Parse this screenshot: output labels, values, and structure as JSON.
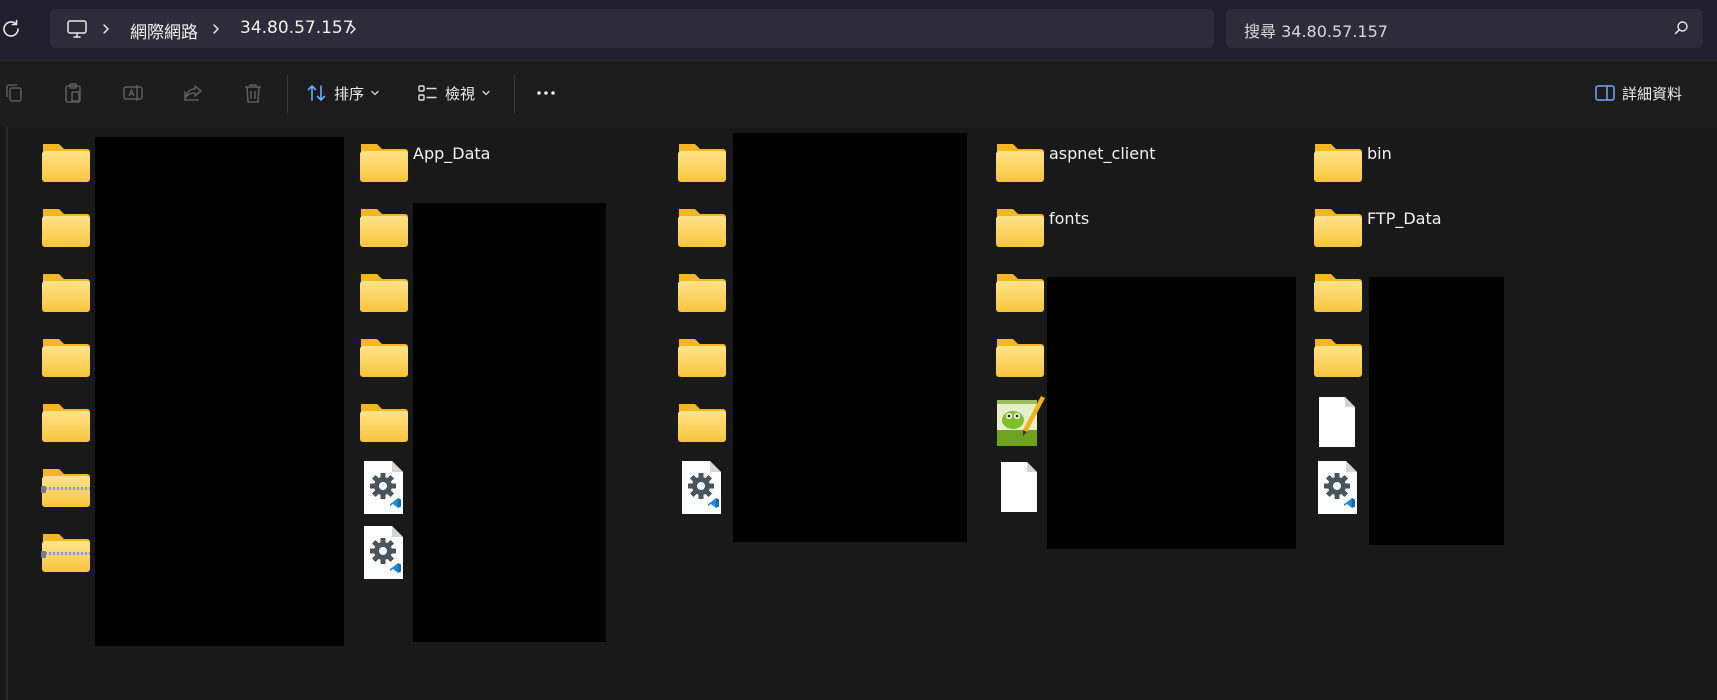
{
  "address": {
    "crumbs": [
      "網際網路",
      "34.80.57.157"
    ]
  },
  "search": {
    "placeholder": "搜尋 34.80.57.157"
  },
  "toolbar": {
    "sort_label": "排序",
    "view_label": "檢視",
    "details_label": "詳細資料"
  },
  "items": {
    "app_data": "App_Data",
    "aspnet_client": "aspnet_client",
    "bin": "bin",
    "fonts": "fonts",
    "ftp_data": "FTP_Data"
  },
  "colors": {
    "background": "#191919",
    "titlebar": "#211f2b",
    "address_bar": "#2e2c38",
    "folder_yellow": "#ffd65c",
    "folder_tab": "#f5b623"
  },
  "icons": {
    "folder": "folder-icon",
    "zip": "zip-folder-icon",
    "config": "config-file-icon",
    "blank": "blank-file-icon",
    "notepadpp": "notepadpp-file-icon"
  }
}
